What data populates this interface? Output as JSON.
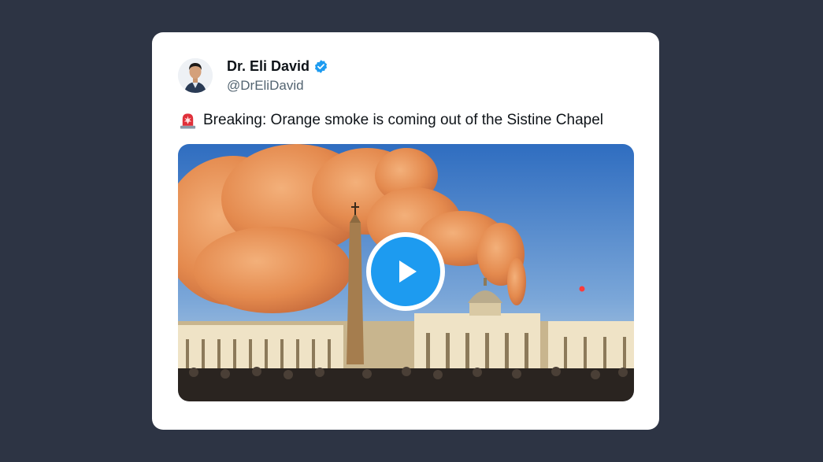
{
  "author": {
    "name": "Dr. Eli David",
    "handle": "@DrEliDavid",
    "verified": true,
    "avatar_icon": "person-avatar"
  },
  "tweet": {
    "icon": "rotating-light-siren-icon",
    "text": "Breaking: Orange smoke is coming out of the Sistine Chapel"
  },
  "media": {
    "type": "video",
    "play_icon": "play-icon",
    "description_icon": "vatican-orange-smoke-image"
  },
  "colors": {
    "background": "#2d3444",
    "card": "#ffffff",
    "verified_blue": "#1d9bf0",
    "smoke": "#e8955a",
    "sky": "#3a78c6"
  }
}
